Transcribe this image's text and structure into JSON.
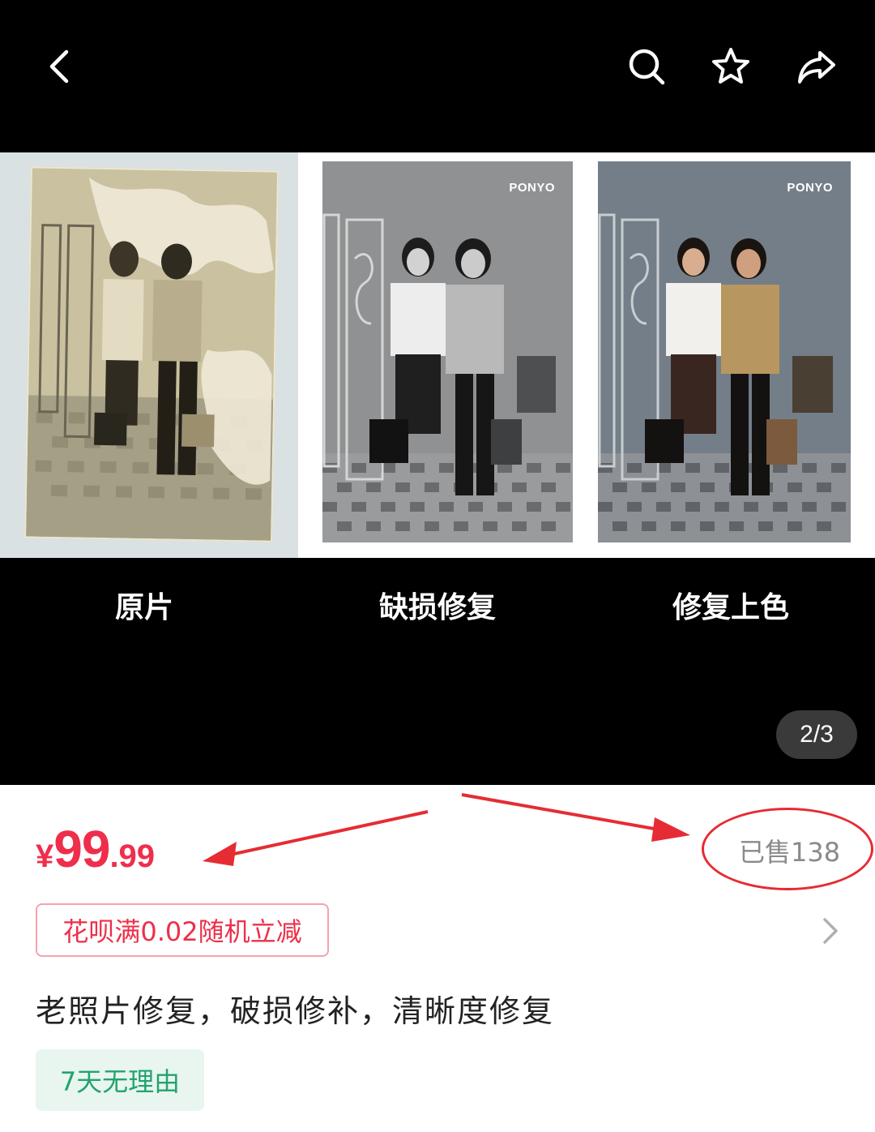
{
  "header": {
    "back_icon": "chevron-left-icon",
    "search_icon": "search-icon",
    "favorite_icon": "star-icon",
    "share_icon": "share-arrow-icon"
  },
  "gallery": {
    "panels": [
      {
        "caption": "原片",
        "watermark": ""
      },
      {
        "caption": "缺损修复",
        "watermark": "PONYO"
      },
      {
        "caption": "修复上色",
        "watermark": "PONYO"
      }
    ],
    "page_indicator": "2/3"
  },
  "product": {
    "price_symbol": "¥",
    "price_integer": "99",
    "price_decimal": ".99",
    "sold_label": "已售138",
    "coupon_label": "花呗满0.02随机立减",
    "title": "老照片修复，破损修补，清晰度修复",
    "tag_label": "7天无理由"
  },
  "colors": {
    "price": "#ef2e4c",
    "annotation_red": "#e52c34",
    "tag_green": "#22a46e",
    "tag_bg": "#e9f5ef"
  }
}
